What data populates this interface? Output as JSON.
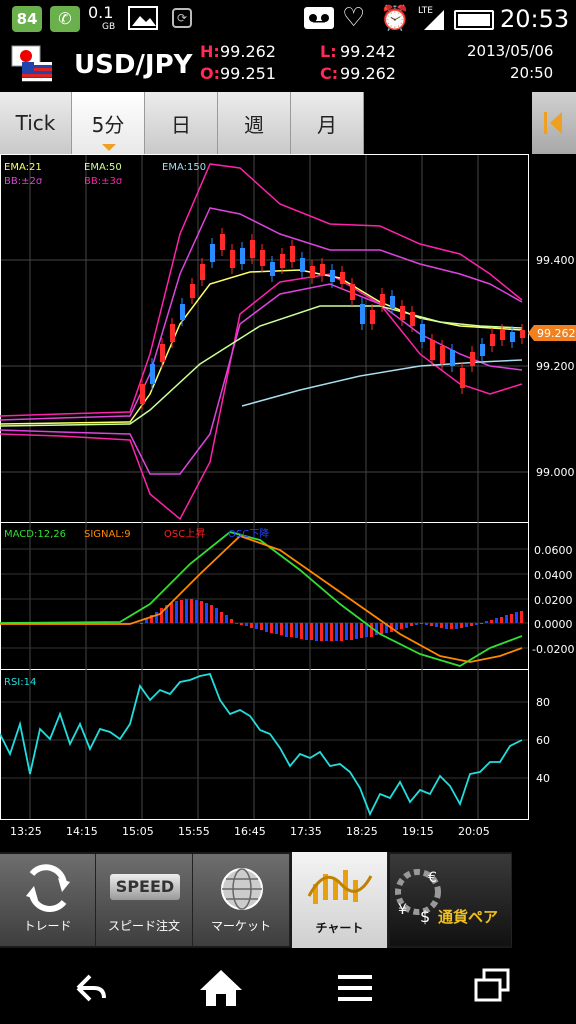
{
  "status_bar": {
    "battery": "84",
    "data_amount": "0.1",
    "data_unit": "GB",
    "network": "LTE",
    "time": "20:53"
  },
  "header": {
    "pair": "USD/JPY",
    "high_label": "H:",
    "high": "99.262",
    "open_label": "O:",
    "open": "99.251",
    "low_label": "L:",
    "low": "99.242",
    "close_label": "C:",
    "close": "99.262",
    "date": "2013/05/06",
    "time": "20:50"
  },
  "tabs": [
    {
      "label": "Tick"
    },
    {
      "label": "5分",
      "active": true
    },
    {
      "label": "日"
    },
    {
      "label": "週"
    },
    {
      "label": "月"
    }
  ],
  "main_chart": {
    "legend": {
      "ema21": "EMA:21",
      "ema50": "EMA:50",
      "ema150": "EMA:150",
      "bb2": "BB:±2σ",
      "bb3": "BB:±3σ"
    },
    "y_ticks": [
      "99.400",
      "99.200",
      "99.000"
    ],
    "current_price": "99.262",
    "colors": {
      "ema21": "#ffff66",
      "ema50": "#ccff99",
      "ema150": "#aaddee",
      "bb2": "#dd44dd",
      "bb3": "#ff22aa",
      "up": "#ff2a2a",
      "down": "#2a8cff"
    }
  },
  "macd_panel": {
    "legend": {
      "macd": "MACD:12,26",
      "signal": "SIGNAL:9",
      "osc_up": "OSC上昇",
      "osc_down": "OSC下降"
    },
    "y_ticks": [
      "0.0600",
      "0.0400",
      "0.0200",
      "0.0000",
      "-0.0200"
    ],
    "colors": {
      "macd": "#33dd33",
      "signal": "#ff8800",
      "osc_up": "#ff2222",
      "osc_down": "#2244ff"
    }
  },
  "rsi_panel": {
    "legend": {
      "rsi": "RSI:14"
    },
    "y_ticks": [
      "80",
      "60",
      "40"
    ],
    "color": "#22dddd"
  },
  "x_axis": {
    "labels": [
      "13:25",
      "14:15",
      "15:05",
      "15:55",
      "16:45",
      "17:35",
      "18:25",
      "19:15",
      "20:05"
    ]
  },
  "bottom_nav": [
    {
      "label": "トレード",
      "icon": "trade-icon"
    },
    {
      "label": "スピード注文",
      "icon": "speed-icon",
      "badge": "SPEED"
    },
    {
      "label": "マーケット",
      "icon": "globe-icon"
    },
    {
      "label": "チャート",
      "icon": "chart-icon",
      "active": true
    },
    {
      "label": "通貨ペア",
      "icon": "currency-pair-icon"
    }
  ]
}
